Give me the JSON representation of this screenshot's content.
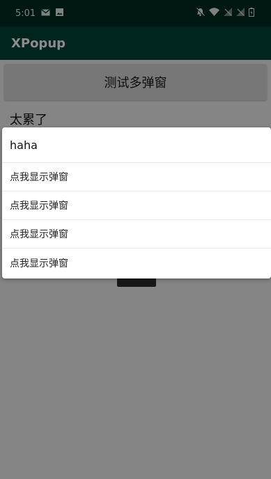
{
  "status_bar": {
    "time": "5:01",
    "left_icons": [
      "mail-icon",
      "image-icon"
    ],
    "right_icons": [
      "notifications-off-icon",
      "wifi-icon",
      "signal-off-icon",
      "signal-off-icon",
      "battery-icon"
    ]
  },
  "app_bar": {
    "title": "XPopup"
  },
  "main": {
    "button_label": "测试多弹窗",
    "edit_text": "太累了"
  },
  "popup": {
    "title": "haha",
    "items": [
      "点我显示弹窗",
      "点我显示弹窗",
      "点我显示弹窗",
      "点我显示弹窗"
    ]
  },
  "colors": {
    "status_bar": "#002a22",
    "app_bar": "#004238",
    "scrim": "rgba(0,0,0,0.45)",
    "popup_bg": "#ffffff"
  }
}
